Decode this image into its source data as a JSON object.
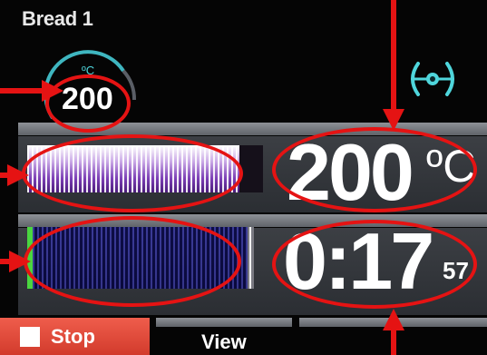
{
  "header": {
    "title": "Bread 1"
  },
  "gauge": {
    "unit": "ºC",
    "setpoint": "200",
    "arc_fraction": 0.55
  },
  "temperature": {
    "value": "200",
    "unit": "ºC",
    "progress": 0.9
  },
  "timer": {
    "value": "0:17",
    "seconds": "57",
    "progress": 0.97
  },
  "buttons": {
    "stop": "Stop",
    "view": "View"
  },
  "icons": {
    "fan": "fan-icon",
    "stop": "stop-square-icon"
  },
  "colors": {
    "background": "#050505",
    "accent_teal": "#4fd6dc",
    "stop_red": "#e0483a",
    "annotation_red": "#e51313",
    "timer_bar_blue": "#1a1a7a",
    "timer_marker_green": "#4ad640",
    "temp_bar_purple": "#7c3fb5"
  }
}
